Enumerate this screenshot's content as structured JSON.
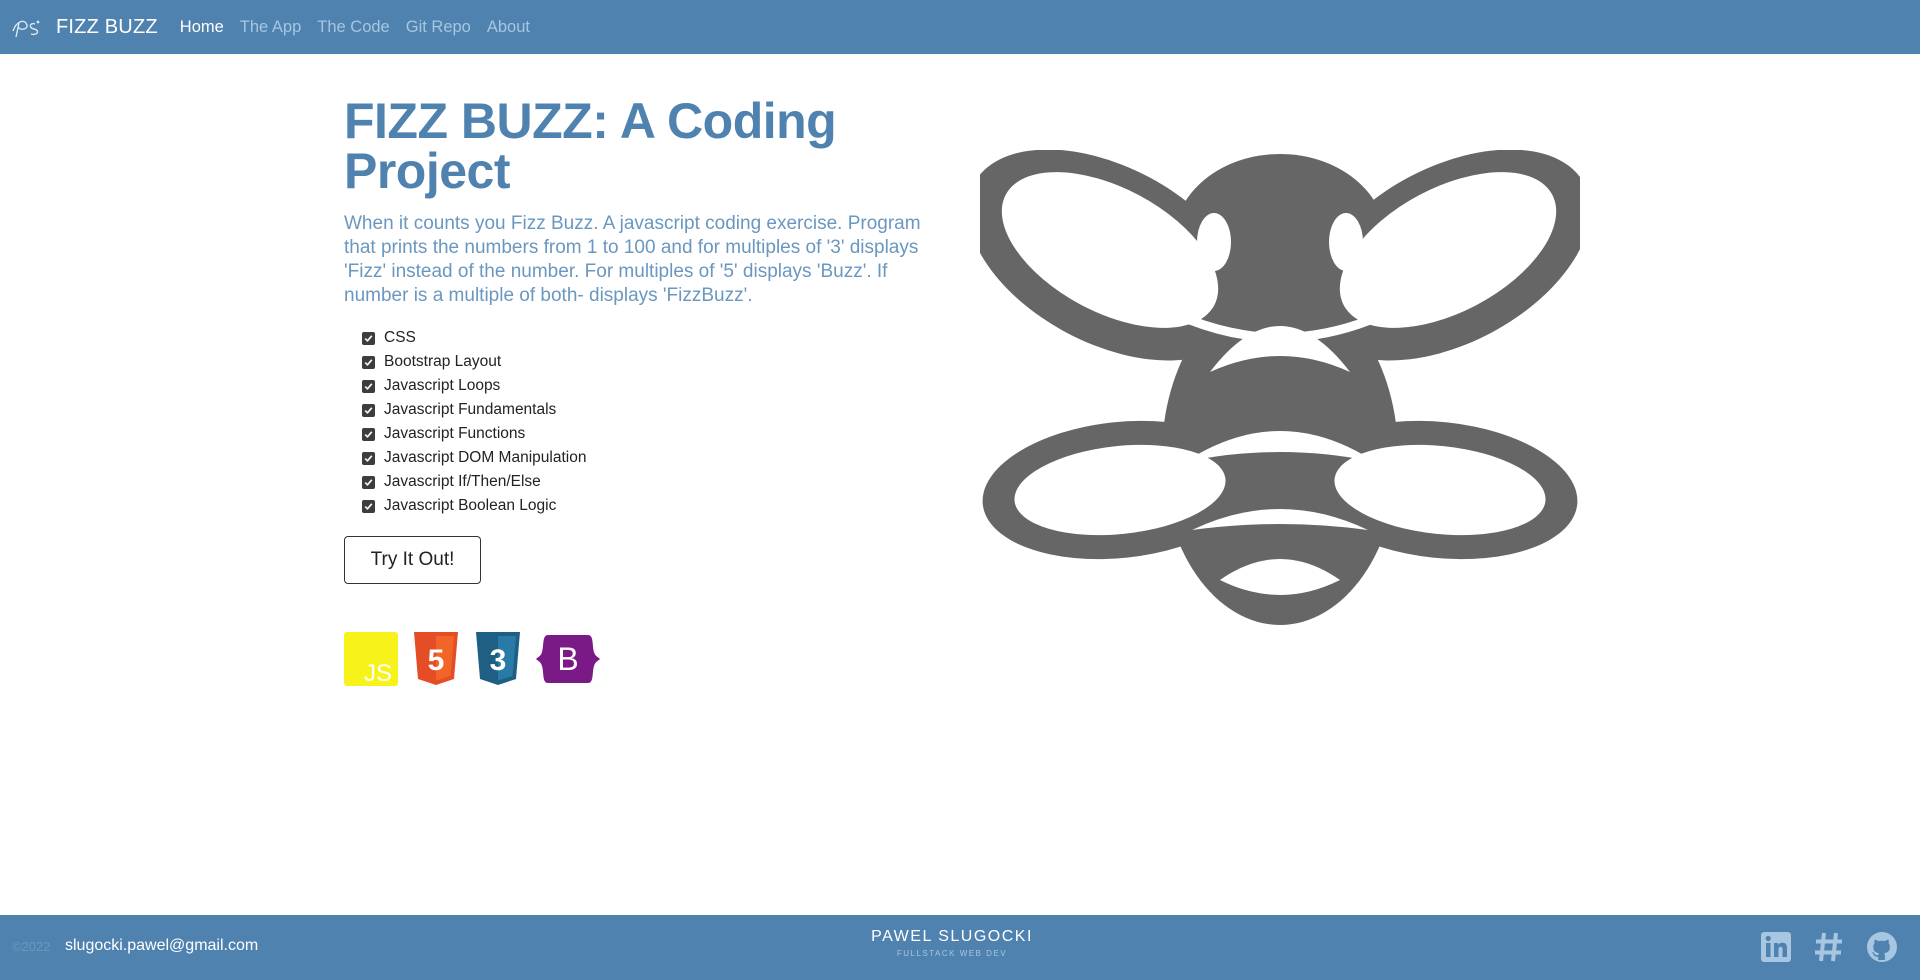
{
  "navbar": {
    "brand_name": "FIZZ BUZZ",
    "links": [
      {
        "label": "Home"
      },
      {
        "label": "The App"
      },
      {
        "label": "The Code"
      },
      {
        "label": "Git Repo"
      },
      {
        "label": "About"
      }
    ],
    "active_link": "Home",
    "background": "#4f82ae"
  },
  "hero": {
    "title": "FIZZ BUZZ: A Coding Project",
    "description": "When it counts you Fizz Buzz. A javascript coding exercise. Program that prints the numbers from 1 to 100 and for multiples of '3' displays 'Fizz' instead of the number. For multiples of '5' displays 'Buzz'. If number is a multiple of both- displays 'FizzBuzz'.",
    "features": [
      "CSS",
      "Bootstrap Layout",
      "Javascript Loops",
      "Javascript Fundamentals",
      "Javascript Functions",
      "Javascript DOM Manipulation",
      "Javascript If/Then/Else",
      "Javascript Boolean Logic"
    ],
    "cta_label": "Try It Out!",
    "tech_icons": [
      {
        "name": "javascript-icon",
        "label": "JS",
        "color": "#f7df1e"
      },
      {
        "name": "html5-icon",
        "label": "5",
        "color": "#e44d26"
      },
      {
        "name": "css3-icon",
        "label": "3",
        "color": "#1f5f83"
      },
      {
        "name": "bootstrap-icon",
        "label": "B",
        "color": "#7a1a87"
      }
    ],
    "bee_color": "#666666"
  },
  "footer": {
    "copyright": "©2022",
    "email": "slugocki.pawel@gmail.com",
    "name": "PAWEL SLUGOCKI",
    "tagline": "FULLSTACK WEB DEV",
    "social": [
      "linkedin-icon",
      "hashtag-icon",
      "github-icon"
    ]
  }
}
